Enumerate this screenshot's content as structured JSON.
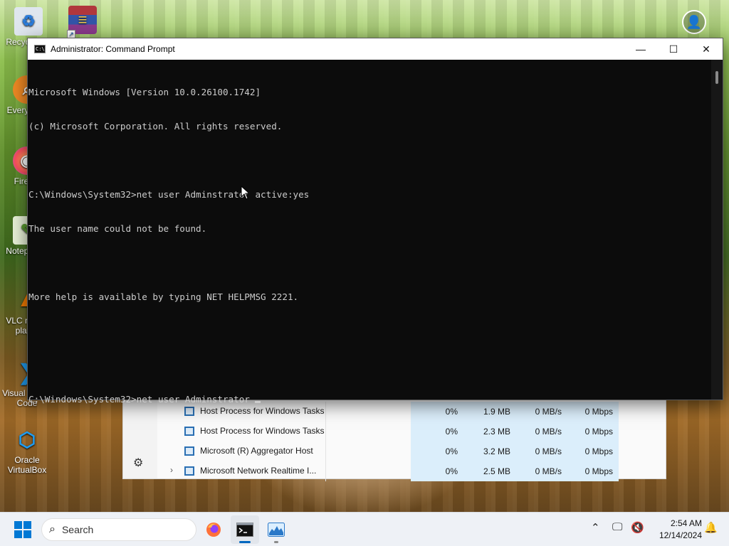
{
  "desktop": {
    "icons": [
      {
        "label": "Recycle Bin",
        "icon": "recycle-bin-icon"
      },
      {
        "label": "WinRAR",
        "icon": "winrar-icon"
      },
      {
        "label": "Everything",
        "icon": "everything-icon"
      },
      {
        "label": "Firefox",
        "icon": "firefox-icon"
      },
      {
        "label": "Notepad++",
        "icon": "notepad-plus-plus-icon"
      },
      {
        "label": "VLC media player",
        "icon": "vlc-icon"
      },
      {
        "label": "Visual Studio Code",
        "icon": "vscode-icon"
      },
      {
        "label": "Oracle VirtualBox",
        "icon": "virtualbox-icon"
      }
    ]
  },
  "cmd_window": {
    "title": "Administrator: Command Prompt",
    "lines": [
      "Microsoft Windows [Version 10.0.26100.1742]",
      "(c) Microsoft Corporation. All rights reserved.",
      "",
      "C:\\Windows\\System32>net user Adminstrator active:yes",
      "The user name could not be found.",
      "",
      "More help is available by typing NET HELPMSG 2221.",
      "",
      "",
      "C:\\Windows\\System32>net user Adminstrator "
    ]
  },
  "task_manager": {
    "rows": [
      {
        "name": "Host Process for Windows Tasks",
        "cpu": "0%",
        "memory": "1.9 MB",
        "disk": "0 MB/s",
        "network": "0 Mbps",
        "expandable": false
      },
      {
        "name": "Host Process for Windows Tasks",
        "cpu": "0%",
        "memory": "2.3 MB",
        "disk": "0 MB/s",
        "network": "0 Mbps",
        "expandable": false
      },
      {
        "name": "Microsoft (R) Aggregator Host",
        "cpu": "0%",
        "memory": "3.2 MB",
        "disk": "0 MB/s",
        "network": "0 Mbps",
        "expandable": false
      },
      {
        "name": "Microsoft Network Realtime I...",
        "cpu": "0%",
        "memory": "2.5 MB",
        "disk": "0 MB/s",
        "network": "0 Mbps",
        "expandable": true
      }
    ]
  },
  "taskbar": {
    "search_placeholder": "Search",
    "apps": [
      "firefox-icon",
      "command-prompt-icon",
      "task-manager-icon"
    ],
    "clock": {
      "time": "2:54 AM",
      "date": "12/14/2024"
    }
  },
  "colors": {
    "console_bg": "#0c0c0c",
    "console_fg": "#cccccc",
    "accent": "#0078d4",
    "taskmgr_highlight": "#dbeefb"
  }
}
